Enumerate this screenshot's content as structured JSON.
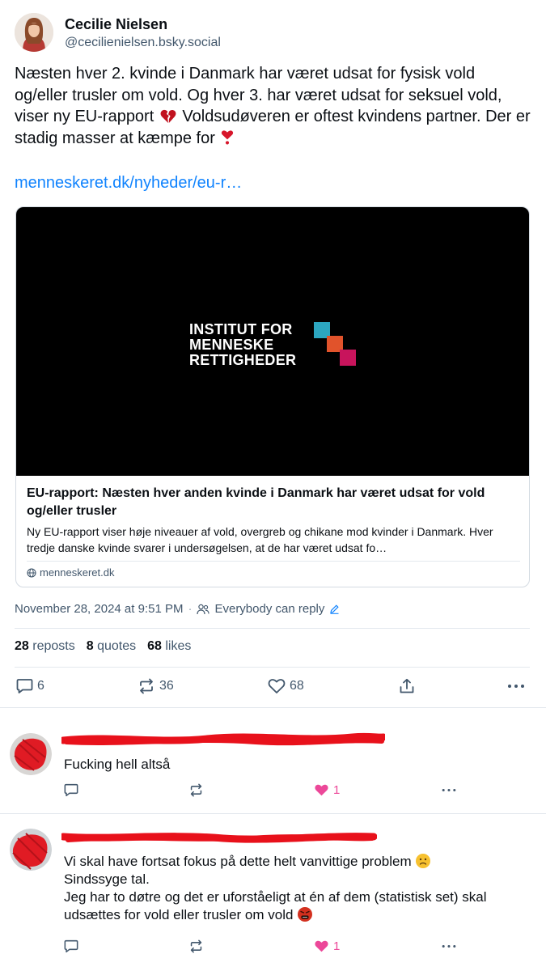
{
  "post": {
    "author_name": "Cecilie Nielsen",
    "author_handle": "@cecilienielsen.bsky.social",
    "text_part1": "Næsten hver 2. kvinde i Danmark har været udsat for fysisk vold og/eller trusler om vold. Og hver 3. har været udsat for seksuel vold, viser ny EU-rapport",
    "text_part2": " Voldsudøveren er oftest kvindens partner. Der er stadig masser at kæmpe for",
    "link": "menneskeret.dk/nyheder/eu-r…",
    "timestamp": "November 28, 2024 at 9:51 PM",
    "reply_setting": "Everybody can reply",
    "stats": {
      "reposts_count": "28",
      "reposts_label": "reposts",
      "quotes_count": "8",
      "quotes_label": "quotes",
      "likes_count": "68",
      "likes_label": "likes"
    },
    "actions": {
      "replies": "6",
      "reposts": "36",
      "likes": "68"
    }
  },
  "link_card": {
    "logo_line1": "INSTITUT FOR",
    "logo_line2": "MENNESKE",
    "logo_line3": "RETTIGHEDER",
    "title": "EU-rapport: Næsten hver anden kvinde i Danmark har været udsat for vold og/eller trusler",
    "description": "Ny EU-rapport viser høje niveauer af vold, overgreb og chikane mod kvinder i Danmark. Hver tredje danske kvinde svarer i undersøgelsen, at de har været udsat fo…",
    "domain": "menneskeret.dk"
  },
  "replies": [
    {
      "text": "Fucking hell altså",
      "likes": "1"
    },
    {
      "line1": "Vi skal have fortsat fokus på dette helt vanvittige problem",
      "line2": "Sindssyge tal.",
      "line3": "Jeg har to døtre og det er uforståeligt at én af dem (statistisk set) skal udsættes for vold eller trusler om vold",
      "likes": "1"
    }
  ],
  "colors": {
    "accent": "#1083fe",
    "muted": "#42576c",
    "like_pink": "#ec4899",
    "logo_cyan": "#2ca6c0",
    "logo_orange": "#e1532b",
    "logo_magenta": "#c8145c",
    "redaction": "#e8111b"
  }
}
